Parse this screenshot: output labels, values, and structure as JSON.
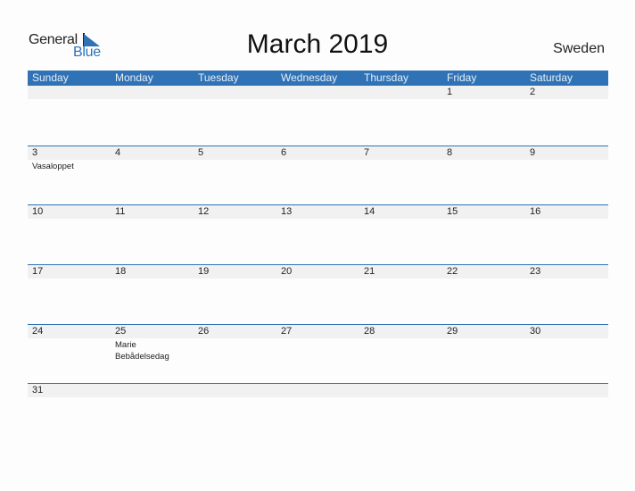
{
  "logo": {
    "line1": "General",
    "line2": "Blue"
  },
  "title": "March 2019",
  "country": "Sweden",
  "colors": {
    "accent": "#2f73b6",
    "band": "#f1f1f1"
  },
  "weekdays": [
    "Sunday",
    "Monday",
    "Tuesday",
    "Wednesday",
    "Thursday",
    "Friday",
    "Saturday"
  ],
  "weeks": [
    [
      {
        "day": "",
        "event": ""
      },
      {
        "day": "",
        "event": ""
      },
      {
        "day": "",
        "event": ""
      },
      {
        "day": "",
        "event": ""
      },
      {
        "day": "",
        "event": ""
      },
      {
        "day": "1",
        "event": ""
      },
      {
        "day": "2",
        "event": ""
      }
    ],
    [
      {
        "day": "3",
        "event": "Vasaloppet"
      },
      {
        "day": "4",
        "event": ""
      },
      {
        "day": "5",
        "event": ""
      },
      {
        "day": "6",
        "event": ""
      },
      {
        "day": "7",
        "event": ""
      },
      {
        "day": "8",
        "event": ""
      },
      {
        "day": "9",
        "event": ""
      }
    ],
    [
      {
        "day": "10",
        "event": ""
      },
      {
        "day": "11",
        "event": ""
      },
      {
        "day": "12",
        "event": ""
      },
      {
        "day": "13",
        "event": ""
      },
      {
        "day": "14",
        "event": ""
      },
      {
        "day": "15",
        "event": ""
      },
      {
        "day": "16",
        "event": ""
      }
    ],
    [
      {
        "day": "17",
        "event": ""
      },
      {
        "day": "18",
        "event": ""
      },
      {
        "day": "19",
        "event": ""
      },
      {
        "day": "20",
        "event": ""
      },
      {
        "day": "21",
        "event": ""
      },
      {
        "day": "22",
        "event": ""
      },
      {
        "day": "23",
        "event": ""
      }
    ],
    [
      {
        "day": "24",
        "event": ""
      },
      {
        "day": "25",
        "event": "Marie Bebådelsedag"
      },
      {
        "day": "26",
        "event": ""
      },
      {
        "day": "27",
        "event": ""
      },
      {
        "day": "28",
        "event": ""
      },
      {
        "day": "29",
        "event": ""
      },
      {
        "day": "30",
        "event": ""
      }
    ],
    [
      {
        "day": "31",
        "event": ""
      },
      {
        "day": "",
        "event": ""
      },
      {
        "day": "",
        "event": ""
      },
      {
        "day": "",
        "event": ""
      },
      {
        "day": "",
        "event": ""
      },
      {
        "day": "",
        "event": ""
      },
      {
        "day": "",
        "event": ""
      }
    ]
  ]
}
